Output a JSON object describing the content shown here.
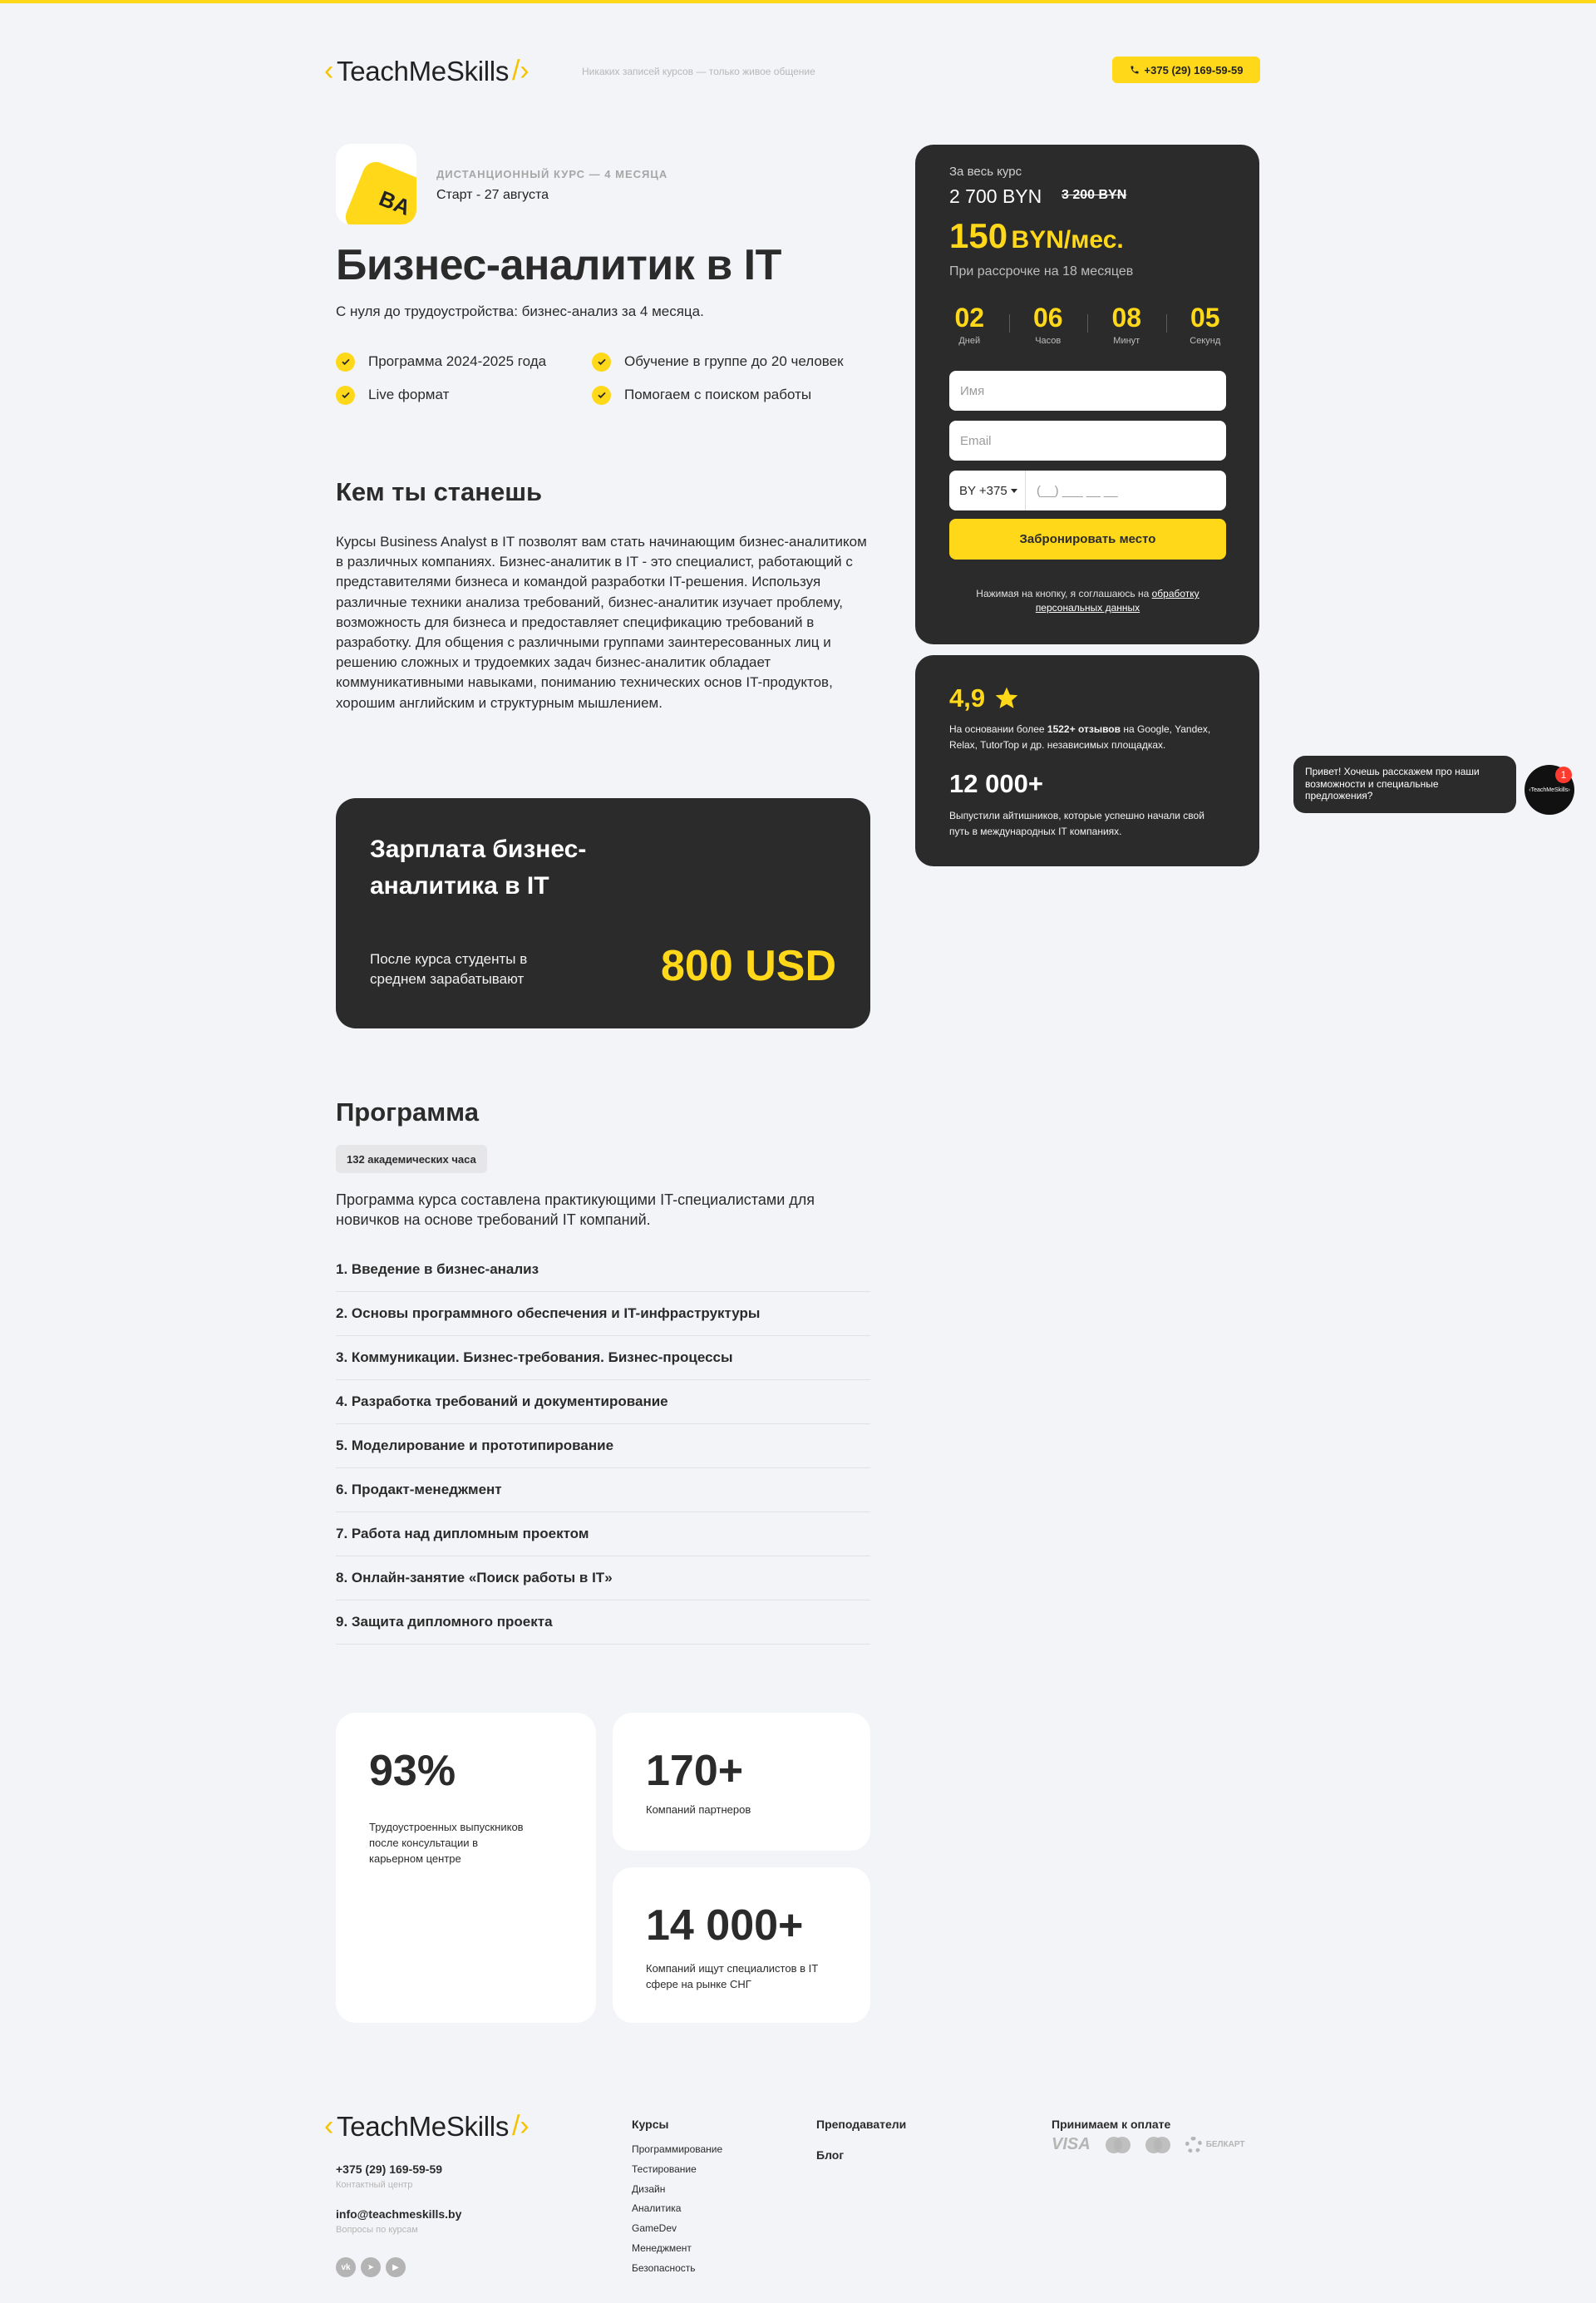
{
  "header": {
    "logo": "TeachMeSkills",
    "slogan": "Никаких записей курсов — только живое общение",
    "phone": "+375 (29) 169-59-59"
  },
  "hero": {
    "kind": "Дистанционный курс — 4 месяца",
    "start": "Старт - 27 августа",
    "icon_text": "BA",
    "title": "Бизнес-аналитик в IT",
    "lead": "С нуля до трудоустройства: бизнес-анализ за 4 месяца.",
    "features": [
      "Программа 2024-2025 года",
      "Обучение в группе до 20 человек",
      "Live формат",
      "Помогаем с поиском работы"
    ]
  },
  "who": {
    "title": "Кем ты станешь",
    "text": "Курсы Business Analyst в IT позволят вам стать начинающим бизнес-аналитиком в различных компаниях. Бизнес-аналитик в IT - это специалист, работающий с представителями бизнеса и командой разработки IT-решения. Используя различные техники анализа требований, бизнес-аналитик изучает проблему, возможность для бизнеса и предоставляет спецификацию требований в разработку. Для общения с различными группами заинтересованных лиц и решению сложных и трудоемких задач бизнес-аналитик обладает коммуникативными навыками, пониманию технических основ IT-продуктов, хорошим английским и структурным мышлением."
  },
  "salary": {
    "title": "Зарплата бизнес-аналитика в IT",
    "desc": "После курса студенты в среднем зарабатывают",
    "value": "800 USD"
  },
  "program": {
    "title": "Программа",
    "hours": "132 академических часа",
    "desc": "Программа курса составлена практикующими IT-специалистами для новичков на основе требований IT компаний.",
    "modules": [
      "1. Введение в бизнес-анализ",
      "2. Основы программного обеспечения и IT-инфраструктуры",
      "3. Коммуникации. Бизнес-требования. Бизнес-процессы",
      "4. Разработка требований и документирование",
      "5. Моделирование и прототипирование",
      "6. Продакт-менеджмент",
      "7. Работа над дипломным проектом",
      "8. Онлайн-занятие «Поиск работы в IT»",
      "9. Защита дипломного проекта"
    ]
  },
  "stats": {
    "employed_value": "93%",
    "employed_caption": "Трудоустроенных выпускников после консультации в карьерном центре",
    "partners_value": "170+",
    "partners_caption": "Компаний партнеров",
    "hiring_value": "14 000+",
    "hiring_caption": "Компаний ищут специалистов в IT сфере на рынке СНГ"
  },
  "price": {
    "label": "За весь курс",
    "full": "2 700 BYN",
    "old": "3 200 BYN",
    "monthly": "150",
    "monthly_unit": "BYN/мес.",
    "installment": "При рассрочке на 18 месяцев",
    "timer": [
      {
        "value": "02",
        "label": "Дней"
      },
      {
        "value": "06",
        "label": "Часов"
      },
      {
        "value": "08",
        "label": "Минут"
      },
      {
        "value": "05",
        "label": "Секунд"
      }
    ],
    "name_placeholder": "Имя",
    "email_placeholder": "Email",
    "country_code": "BY +375",
    "phone_placeholder": "(__) ___ __ __",
    "button": "Забронировать место",
    "consent_prefix": "Нажимая на кнопку, я соглашаюсь на",
    "consent_link": "обработку персональных данных"
  },
  "rating": {
    "value": "4,9",
    "desc_prefix": "На основании более",
    "desc_bold": "1522+ отзывов",
    "desc_suffix": "на Google, Yandex, Relax, TutorTop и др. независимых площадках.",
    "grads_value": "12 000+",
    "grads_desc": "Выпустили айтишников, которые успешно начали свой путь в международных IT компаниях."
  },
  "chat": {
    "message": "Привет! Хочешь расскажем про наши возможности и специальные предложения?",
    "avatar_text": "‹TeachMeSkills›",
    "badge": "1"
  },
  "footer": {
    "logo": "TeachMeSkills",
    "phone": "+375 (29) 169-59-59",
    "phone_caption": "Контактный центр",
    "email": "info@teachmeskills.by",
    "email_caption": "Вопросы по курсам",
    "courses_title": "Курсы",
    "courses": [
      "Программирование",
      "Тестирование",
      "Дизайн",
      "Аналитика",
      "GameDev",
      "Менеджмент",
      "Безопасность"
    ],
    "teachers": "Преподаватели",
    "blog": "Блог",
    "payment_title": "Принимаем к оплате",
    "payment_visa": "VISA",
    "payment_belkart": "БЕЛКАРТ"
  }
}
